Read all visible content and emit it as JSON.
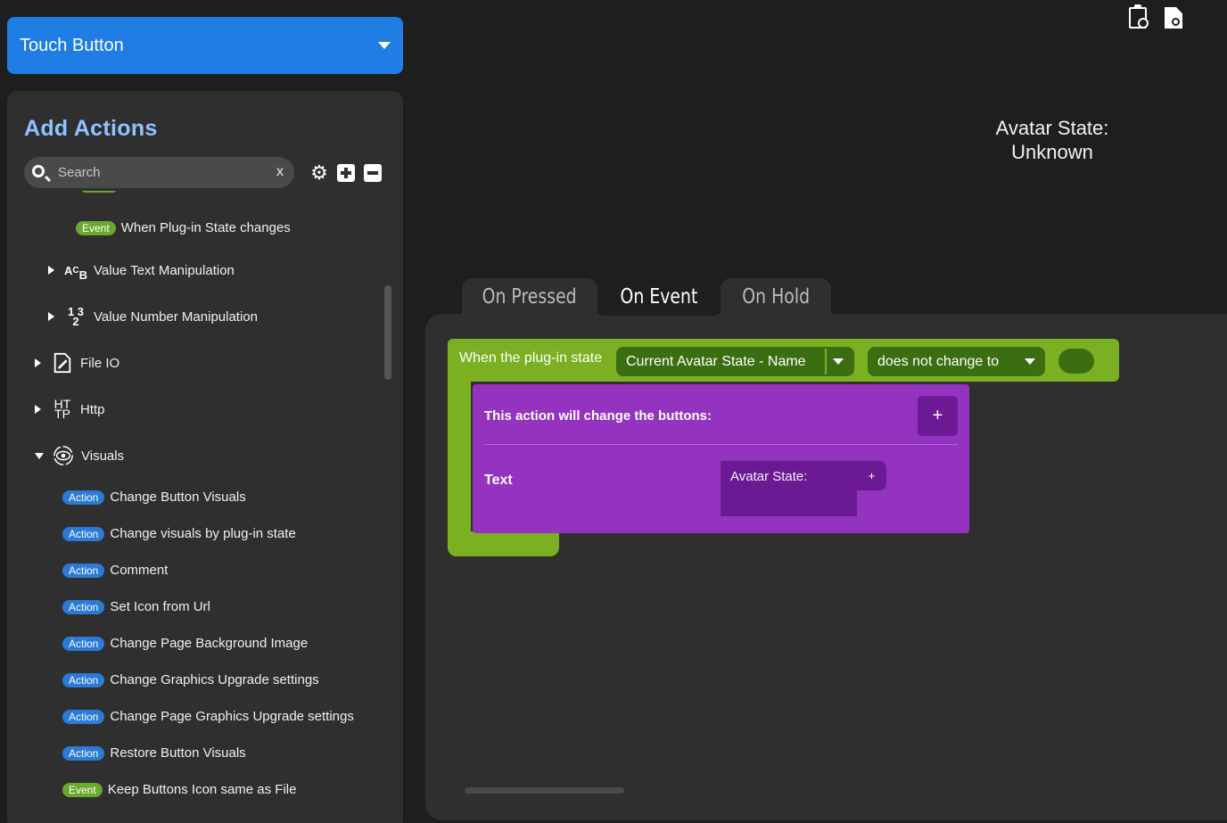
{
  "button_type": {
    "label": "Touch Button"
  },
  "panel": {
    "title": "Add Actions",
    "search": {
      "placeholder": "Search",
      "value": "",
      "clear": "x"
    }
  },
  "tree": {
    "event_plugin_state": {
      "badge": "Event",
      "label": "When Plug-in State changes"
    },
    "value_text": {
      "icon": "A B C",
      "label": "Value Text Manipulation"
    },
    "value_number": {
      "icon": "1 2 3",
      "label": "Value Number Manipulation"
    },
    "file_io": {
      "label": "File IO"
    },
    "http": {
      "icon": "HT TP",
      "label": "Http"
    },
    "visuals": {
      "label": "Visuals"
    },
    "visual_items": [
      {
        "badge": "Action",
        "label": "Change Button Visuals"
      },
      {
        "badge": "Action",
        "label": "Change visuals by plug-in state"
      },
      {
        "badge": "Action",
        "label": "Comment"
      },
      {
        "badge": "Action",
        "label": "Set Icon from Url"
      },
      {
        "badge": "Action",
        "label": "Change Page Background Image"
      },
      {
        "badge": "Action",
        "label": "Change Graphics Upgrade settings"
      },
      {
        "badge": "Action",
        "label": "Change Page Graphics Upgrade settings"
      },
      {
        "badge": "Action",
        "label": "Restore Button Visuals"
      },
      {
        "badge": "Event",
        "label": "Keep Buttons Icon same as File"
      }
    ]
  },
  "preview": {
    "line1": "Avatar State:",
    "line2": "Unknown"
  },
  "tabs": [
    {
      "label": "On Pressed",
      "active": false
    },
    {
      "label": "On Event",
      "active": true
    },
    {
      "label": "On Hold",
      "active": false
    }
  ],
  "event_block": {
    "label": "When the plug-in state",
    "state_select": "Current Avatar State - Name",
    "condition_select": "does not change to",
    "value": ""
  },
  "action_block": {
    "title": "This action will change the buttons:",
    "add_label": "+",
    "field_label": "Text",
    "field_value": "Avatar State:",
    "field_add_label": "+"
  },
  "colors": {
    "accent_blue": "#1f7de3",
    "event_green": "#7bb022",
    "action_purple": "#9333c0",
    "panel_title": "#8fc2ff"
  }
}
